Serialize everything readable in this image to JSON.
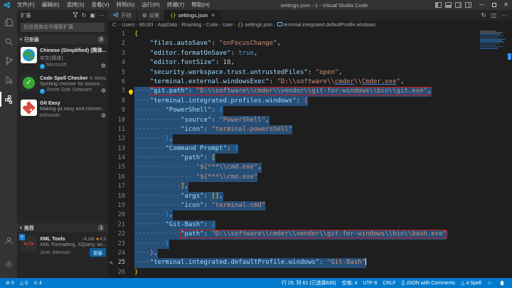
{
  "window": {
    "title": "settings.json - 1 - Visual Studio Code",
    "menus": [
      "文件(F)",
      "编辑(E)",
      "选择(S)",
      "查看(V)",
      "转到(G)",
      "运行(R)",
      "终端(T)",
      "帮助(H)"
    ]
  },
  "sidebar": {
    "title": "扩展",
    "search_placeholder": "在应用商店中搜索扩展",
    "sections": [
      {
        "label": "已安装",
        "badge": "3",
        "items": [
          {
            "icon": "language-extension-icon",
            "name": "Chinese (Simplified) (简体...",
            "desc": "中文(简体)",
            "publisher": "Microsoft",
            "verified": true,
            "gear": true
          },
          {
            "icon": "spell-checker-icon",
            "name": "Code Spell Checker",
            "meta": "↻ 50ms",
            "desc": "Spelling checker for source ...",
            "publisher": "Street Side Software",
            "verified": true,
            "gear": true
          },
          {
            "icon": "git-easy-icon",
            "name": "Git Easy",
            "desc": "Making git easy and conven...",
            "publisher": "bibhasdn",
            "verified": false,
            "gear": true
          }
        ]
      },
      {
        "label": "推荐",
        "badge": "1",
        "items": [
          {
            "icon": "xml-tools-icon",
            "name": "XML Tools",
            "downloads": "4.1M",
            "rating": "4.5",
            "desc": "XML Formatting, XQuery, an...",
            "publisher": "Josh Johnson",
            "install_label": "安装"
          }
        ]
      }
    ]
  },
  "tabs": [
    {
      "icon": "vscode-logo-icon",
      "label": "开始"
    },
    {
      "icon": "gear-icon",
      "label": "设置"
    },
    {
      "icon": "json-braces-icon",
      "label": "settings.json",
      "active": true,
      "close": true
    }
  ],
  "breadcrumb": [
    {
      "label": "C:"
    },
    {
      "label": "Users"
    },
    {
      "label": "86183"
    },
    {
      "label": "AppData"
    },
    {
      "label": "Roaming"
    },
    {
      "label": "Code"
    },
    {
      "label": "User"
    },
    {
      "label": "settings.json",
      "icon": "json-braces-icon"
    },
    {
      "label": "terminal.integrated.defaultProfile.windows",
      "icon": "symbol-property-icon"
    }
  ],
  "editor": {
    "language": "JSON with Comments",
    "lines": [
      {
        "n": 1,
        "segs": [
          [
            "{",
            "b1"
          ]
        ]
      },
      {
        "n": 2,
        "segs": [
          [
            "    ",
            "sp"
          ],
          [
            "\"files.autoSave\"",
            "k"
          ],
          [
            ": ",
            "p"
          ],
          [
            "\"onFocusChange\"",
            "s"
          ],
          [
            ",",
            "p"
          ]
        ]
      },
      {
        "n": 3,
        "segs": [
          [
            "    ",
            "sp"
          ],
          [
            "\"editor.formatOnSave\"",
            "k"
          ],
          [
            ": ",
            "p"
          ],
          [
            "true",
            "kw"
          ],
          [
            ",",
            "p"
          ]
        ]
      },
      {
        "n": 4,
        "segs": [
          [
            "    ",
            "sp"
          ],
          [
            "\"editor.fontSize\"",
            "k"
          ],
          [
            ": ",
            "p"
          ],
          [
            "18",
            "n"
          ],
          [
            ",",
            "p"
          ]
        ]
      },
      {
        "n": 5,
        "segs": [
          [
            "    ",
            "sp"
          ],
          [
            "\"security.workspace.trust.untrustedFiles\"",
            "k"
          ],
          [
            ": ",
            "p"
          ],
          [
            "\"open\"",
            "s"
          ],
          [
            ",",
            "p"
          ]
        ]
      },
      {
        "n": 6,
        "segs": [
          [
            "    ",
            "sp"
          ],
          [
            "\"terminal.external.windowsExec\"",
            "k"
          ],
          [
            ": ",
            "p"
          ],
          [
            "\"D:\\\\software\\\\",
            "s"
          ],
          [
            "cmder",
            "s u"
          ],
          [
            "\\\\",
            "s"
          ],
          [
            "Cmder.exe",
            "s u"
          ],
          [
            "\"",
            "s"
          ],
          [
            ",",
            "p"
          ]
        ]
      },
      {
        "n": 7,
        "sel": true,
        "post": "lightbulb-icon",
        "boxFrom": 1,
        "segs": [
          [
            "····",
            "w"
          ],
          [
            "\"git.path\"",
            "k"
          ],
          [
            ": ",
            "p"
          ],
          [
            "\"D:\\\\software\\\\cmder\\\\vendor\\\\git-for-windows\\\\bin\\\\git.exe\"",
            "s"
          ],
          [
            ",",
            "p"
          ]
        ]
      },
      {
        "n": 8,
        "sel": true,
        "segs": [
          [
            "····",
            "w"
          ],
          [
            "\"terminal.integrated.profiles.windows\"",
            "k"
          ],
          [
            ": ",
            "p"
          ],
          [
            "{",
            "b2"
          ]
        ]
      },
      {
        "n": 9,
        "sel": true,
        "segs": [
          [
            "········",
            "w"
          ],
          [
            "\"PowerShell\"",
            "k"
          ],
          [
            ": ",
            "p"
          ],
          [
            "{",
            "b3"
          ]
        ]
      },
      {
        "n": 10,
        "sel": true,
        "segs": [
          [
            "············",
            "w"
          ],
          [
            "\"source\"",
            "k"
          ],
          [
            ": ",
            "p"
          ],
          [
            "\"PowerShell\"",
            "s"
          ],
          [
            ",",
            "p"
          ]
        ]
      },
      {
        "n": 11,
        "sel": true,
        "segs": [
          [
            "············",
            "w"
          ],
          [
            "\"icon\"",
            "k"
          ],
          [
            ": ",
            "p"
          ],
          [
            "\"terminal-powershell\"",
            "s"
          ]
        ]
      },
      {
        "n": 12,
        "sel": true,
        "segs": [
          [
            "········",
            "w"
          ],
          [
            "}",
            "b3"
          ],
          [
            ",",
            "p"
          ]
        ]
      },
      {
        "n": 13,
        "sel": true,
        "segs": [
          [
            "········",
            "w"
          ],
          [
            "\"Command Prompt\"",
            "k"
          ],
          [
            ": ",
            "p"
          ],
          [
            "{",
            "b3"
          ]
        ]
      },
      {
        "n": 14,
        "sel": true,
        "segs": [
          [
            "············",
            "w"
          ],
          [
            "\"path\"",
            "k"
          ],
          [
            ": ",
            "p"
          ],
          [
            "[",
            "b1"
          ]
        ]
      },
      {
        "n": 15,
        "sel": true,
        "segs": [
          [
            "················",
            "w"
          ],
          [
            "\"${***\\\\cmd.exe\"",
            "s"
          ],
          [
            ",",
            "p"
          ]
        ]
      },
      {
        "n": 16,
        "sel": true,
        "segs": [
          [
            "················",
            "w"
          ],
          [
            "\"${***\\\\cmd.exe\"",
            "s"
          ]
        ]
      },
      {
        "n": 17,
        "sel": true,
        "segs": [
          [
            "············",
            "w"
          ],
          [
            "]",
            "b1"
          ],
          [
            ",",
            "p"
          ]
        ]
      },
      {
        "n": 18,
        "sel": true,
        "segs": [
          [
            "············",
            "w"
          ],
          [
            "\"args\"",
            "k"
          ],
          [
            ": ",
            "p"
          ],
          [
            "[]",
            "b1"
          ],
          [
            ",",
            "p"
          ]
        ]
      },
      {
        "n": 19,
        "sel": true,
        "segs": [
          [
            "············",
            "w"
          ],
          [
            "\"icon\"",
            "k"
          ],
          [
            ": ",
            "p"
          ],
          [
            "\"terminal-cmd\"",
            "s"
          ]
        ]
      },
      {
        "n": 20,
        "sel": true,
        "segs": [
          [
            "········",
            "w"
          ],
          [
            "}",
            "b3"
          ],
          [
            ",",
            "p"
          ]
        ]
      },
      {
        "n": 21,
        "sel": true,
        "segs": [
          [
            "········",
            "w"
          ],
          [
            "\"Git-Bash\"",
            "k"
          ],
          [
            ": ",
            "p"
          ],
          [
            "{",
            "b3"
          ]
        ]
      },
      {
        "n": 22,
        "sel": true,
        "boxFrom": 1,
        "segs": [
          [
            "············",
            "w"
          ],
          [
            "\"path\"",
            "k"
          ],
          [
            ": ",
            "p"
          ],
          [
            "\"D:\\\\software\\\\cmder\\\\vendor\\\\git-for-windows\\\\bin\\\\bash.exe\"",
            "s"
          ]
        ]
      },
      {
        "n": 23,
        "sel": true,
        "segs": [
          [
            "········",
            "w"
          ],
          [
            "}",
            "b3"
          ]
        ]
      },
      {
        "n": 24,
        "sel": true,
        "segs": [
          [
            "····",
            "w"
          ],
          [
            "}",
            "b2"
          ],
          [
            ",",
            "p"
          ]
        ]
      },
      {
        "n": 25,
        "sel": true,
        "active": true,
        "pre": "pencil-icon",
        "cursor": true,
        "segs": [
          [
            "····",
            "w"
          ],
          [
            "\"terminal.integrated.defaultProfile.windows\"",
            "k"
          ],
          [
            ": ",
            "p"
          ],
          [
            "\"Git-Bash\"",
            "s"
          ]
        ]
      },
      {
        "n": 26,
        "segs": [
          [
            "}",
            "b1"
          ]
        ]
      }
    ]
  },
  "status_bar": {
    "left": [
      {
        "icon": "error-icon",
        "label": "0"
      },
      {
        "icon": "warning-icon",
        "label": "0"
      },
      {
        "icon": "info-icon",
        "label": "4"
      }
    ],
    "right": [
      {
        "label": "行 25, 列 61 (已选择635)"
      },
      {
        "label": "空格: 4"
      },
      {
        "label": "UTF-8"
      },
      {
        "label": "CRLF"
      },
      {
        "icon": "braces-icon",
        "label": "JSON with Comments"
      },
      {
        "icon": "warning-icon",
        "label": "4 Spell"
      },
      {
        "icon": "feedback-icon",
        "label": ""
      },
      {
        "icon": "bell-icon",
        "label": ""
      }
    ]
  },
  "colors": {
    "accent": "#007acc",
    "selection": "#264f78",
    "annotation_red": "#d21414",
    "key": "#9cdcfe",
    "string": "#ce9178",
    "number": "#b5cea8",
    "keyword": "#569cd6"
  }
}
